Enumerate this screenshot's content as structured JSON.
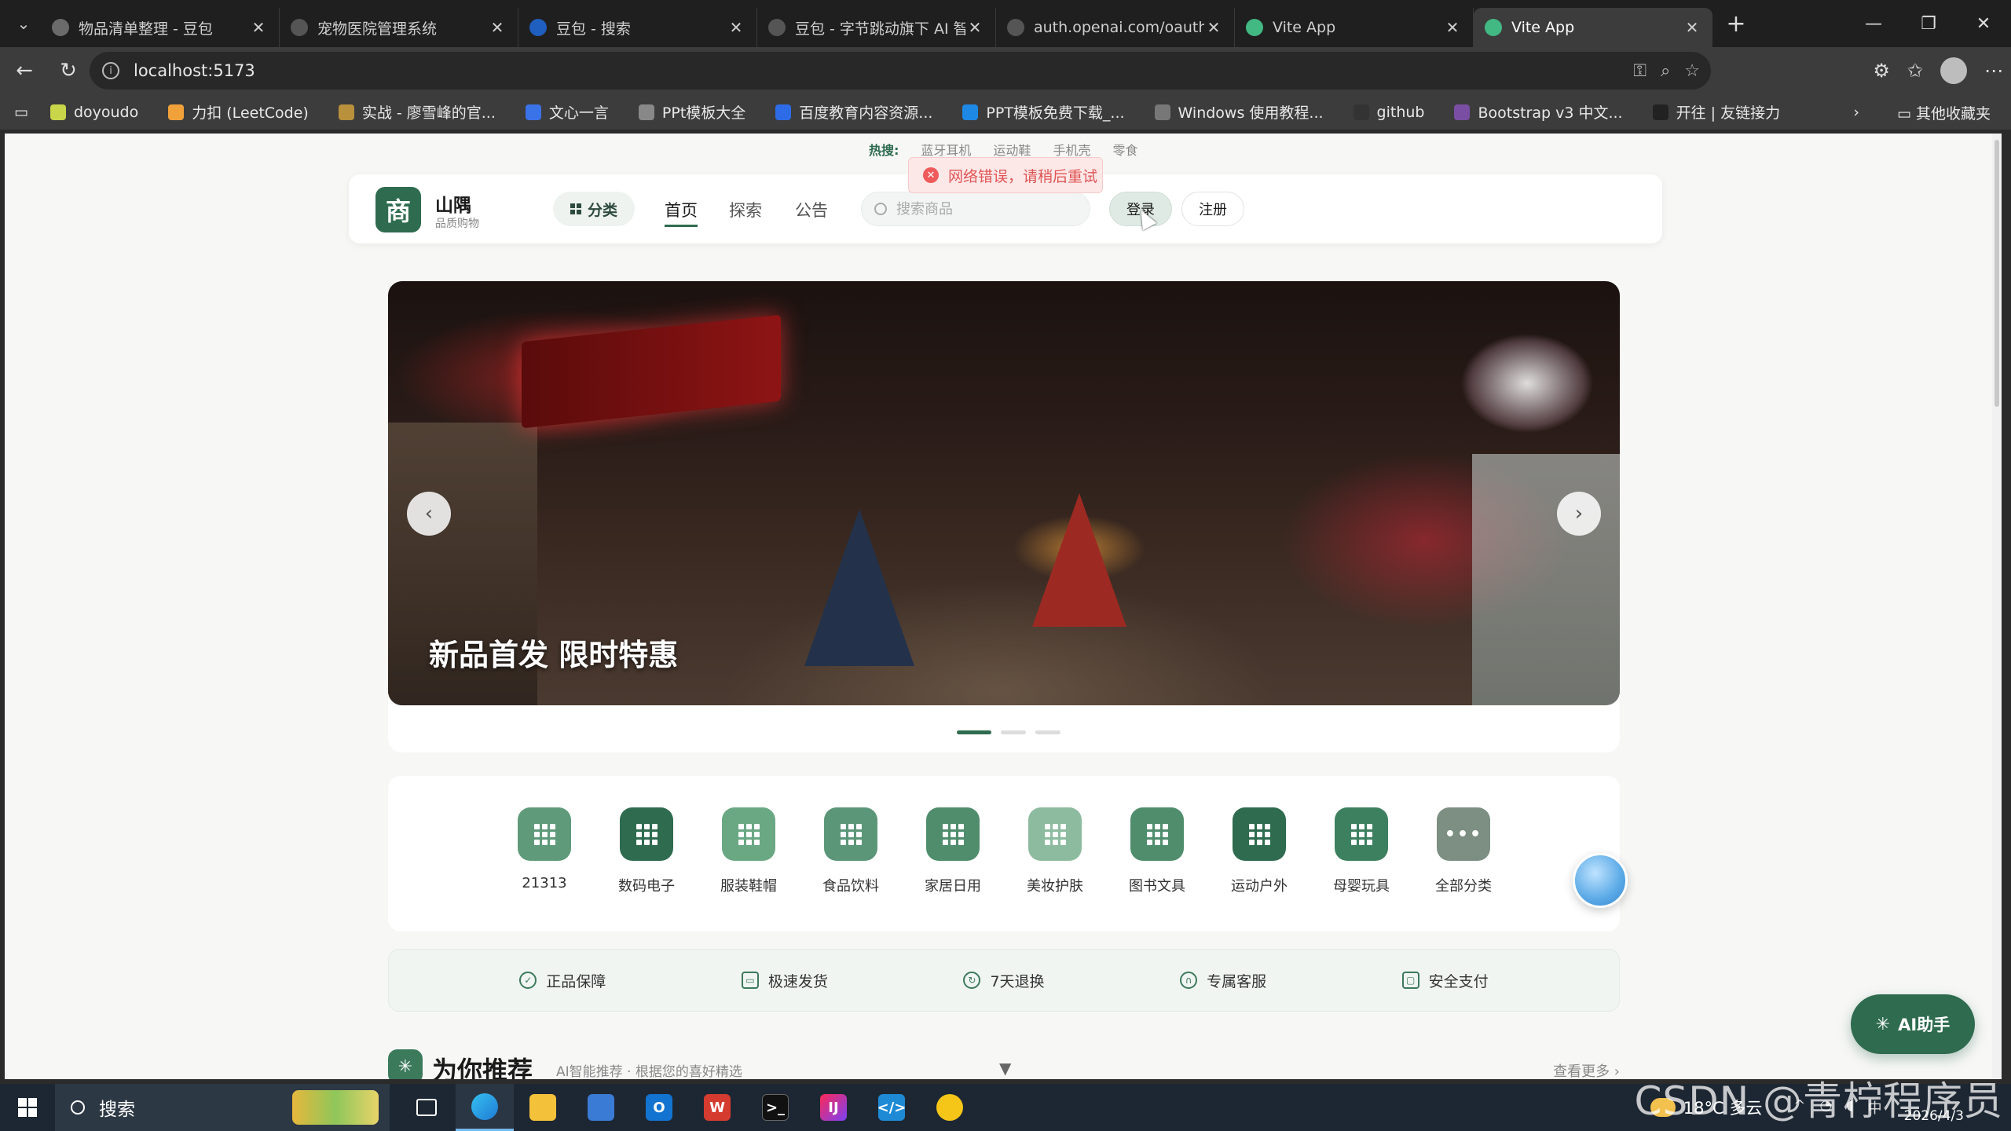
{
  "browser": {
    "tabs": [
      {
        "title": "物品清单整理 - 豆包",
        "favicon_color": "#6b6b6b",
        "active": false
      },
      {
        "title": "宠物医院管理系统",
        "favicon_color": "#555555",
        "active": false
      },
      {
        "title": "豆包 - 搜索",
        "favicon_color": "#1f5fbf",
        "active": false
      },
      {
        "title": "豆包 - 字节跳动旗下 AI 智能",
        "favicon_color": "#555555",
        "active": false
      },
      {
        "title": "auth.openai.com/oauth/auth",
        "favicon_color": "#555555",
        "active": false
      },
      {
        "title": "Vite App",
        "favicon_color": "#42b883",
        "active": false
      },
      {
        "title": "Vite App",
        "favicon_color": "#42b883",
        "active": true
      }
    ],
    "url": "localhost:5173",
    "bookmarks": [
      {
        "label": "doyoudo",
        "color": "#c9d64a"
      },
      {
        "label": "力扣 (LeetCode)",
        "color": "#f0a13a"
      },
      {
        "label": "实战 - 廖雪峰的官...",
        "color": "#b9903c"
      },
      {
        "label": "文心一言",
        "color": "#3a72e8"
      },
      {
        "label": "PPt模板大全",
        "color": "#888888"
      },
      {
        "label": "百度教育内容资源...",
        "color": "#2e6be6"
      },
      {
        "label": "PPT模板免费下载_...",
        "color": "#1e88e5"
      },
      {
        "label": "Windows 使用教程...",
        "color": "#777777"
      },
      {
        "label": "github",
        "color": "#333333"
      },
      {
        "label": "Bootstrap v3 中文...",
        "color": "#7a4ea3"
      },
      {
        "label": "开往 | 友链接力",
        "color": "#222222"
      }
    ],
    "other_bookmarks": "其他收藏夹"
  },
  "page": {
    "hot_search": {
      "label": "热搜:",
      "items": [
        "蓝牙耳机",
        "运动鞋",
        "手机壳",
        "零食"
      ]
    },
    "toast": "网络错误，请稍后重试",
    "header": {
      "logo_char": "商",
      "brand_name": "山隅",
      "brand_sub": "品质购物",
      "category_btn": "分类",
      "nav": [
        "首页",
        "探索",
        "公告"
      ],
      "search_placeholder": "搜索商品",
      "login": "登录",
      "register": "注册"
    },
    "banner": {
      "title": "新品首发 限时特惠",
      "slides": 3,
      "active_slide": 1
    },
    "categories": [
      {
        "label": "21313",
        "color": "#5f9a7a"
      },
      {
        "label": "数码电子",
        "color": "#2e6b4f"
      },
      {
        "label": "服装鞋帽",
        "color": "#6aa884"
      },
      {
        "label": "食品饮料",
        "color": "#5c9679"
      },
      {
        "label": "家居日用",
        "color": "#4f8d6d"
      },
      {
        "label": "美妆护肤",
        "color": "#8dbb9f"
      },
      {
        "label": "图书文具",
        "color": "#4f8d6d"
      },
      {
        "label": "运动户外",
        "color": "#2e6b4f"
      },
      {
        "label": "母婴玩具",
        "color": "#3d8060"
      },
      {
        "label": "全部分类",
        "color": "#7c8f82",
        "more": true
      }
    ],
    "guarantees": [
      "正品保障",
      "极速发货",
      "7天退换",
      "专属客服",
      "安全支付"
    ],
    "recommend": {
      "title": "为你推荐",
      "subtitle": "AI智能推荐 · 根据您的喜好精选",
      "more": "查看更多 ›"
    },
    "ai_button": "AI助手"
  },
  "taskbar": {
    "search": "搜索",
    "weather": "18°C 多云",
    "date": "2026/4/3",
    "watermark": "CSDN @青柠程序员"
  }
}
